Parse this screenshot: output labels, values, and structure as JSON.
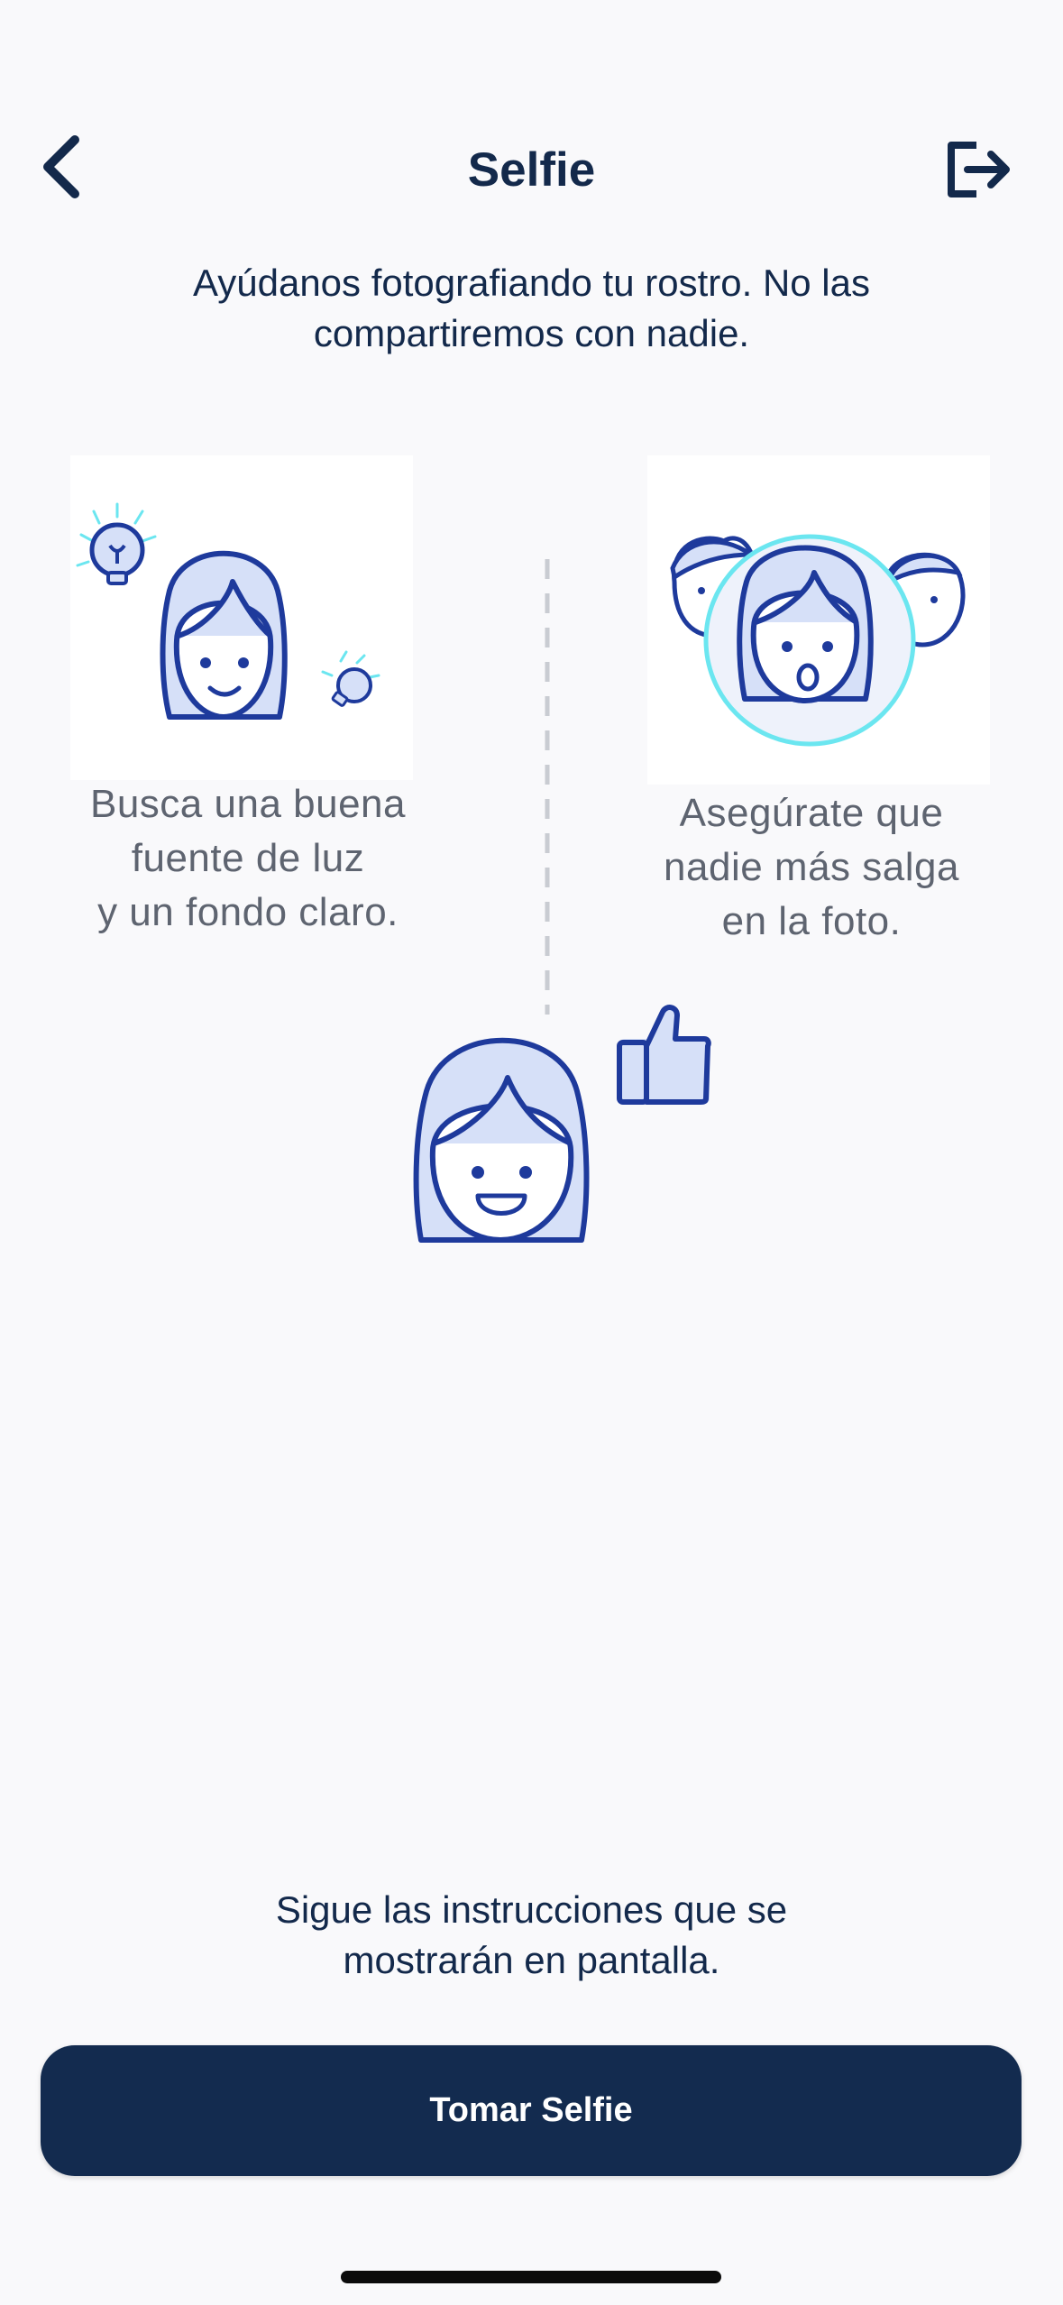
{
  "header": {
    "title": "Selfie",
    "back_icon": "chevron-left-icon",
    "exit_icon": "logout-icon"
  },
  "subtitle_lines": [
    "Ayúdanos fotografiando tu rostro. No las",
    "compartiremos con nadie."
  ],
  "tips": {
    "left_lines": [
      "Busca una buena",
      "fuente de luz",
      "y un fondo claro."
    ],
    "right_lines": [
      "Asegúrate que",
      "nadie más salga",
      "en la foto."
    ]
  },
  "instructions_lines": [
    "Sigue las instrucciones que se",
    "mostrarán en pantalla."
  ],
  "cta": {
    "label": "Tomar Selfie"
  },
  "colors": {
    "primary": "#132b4f",
    "illustration_stroke": "#1e3a9c",
    "illustration_fill": "#d6e0f8",
    "accent_cyan": "#6be6f0",
    "caption_gray": "#5e6470",
    "background": "#f9f9fb"
  }
}
